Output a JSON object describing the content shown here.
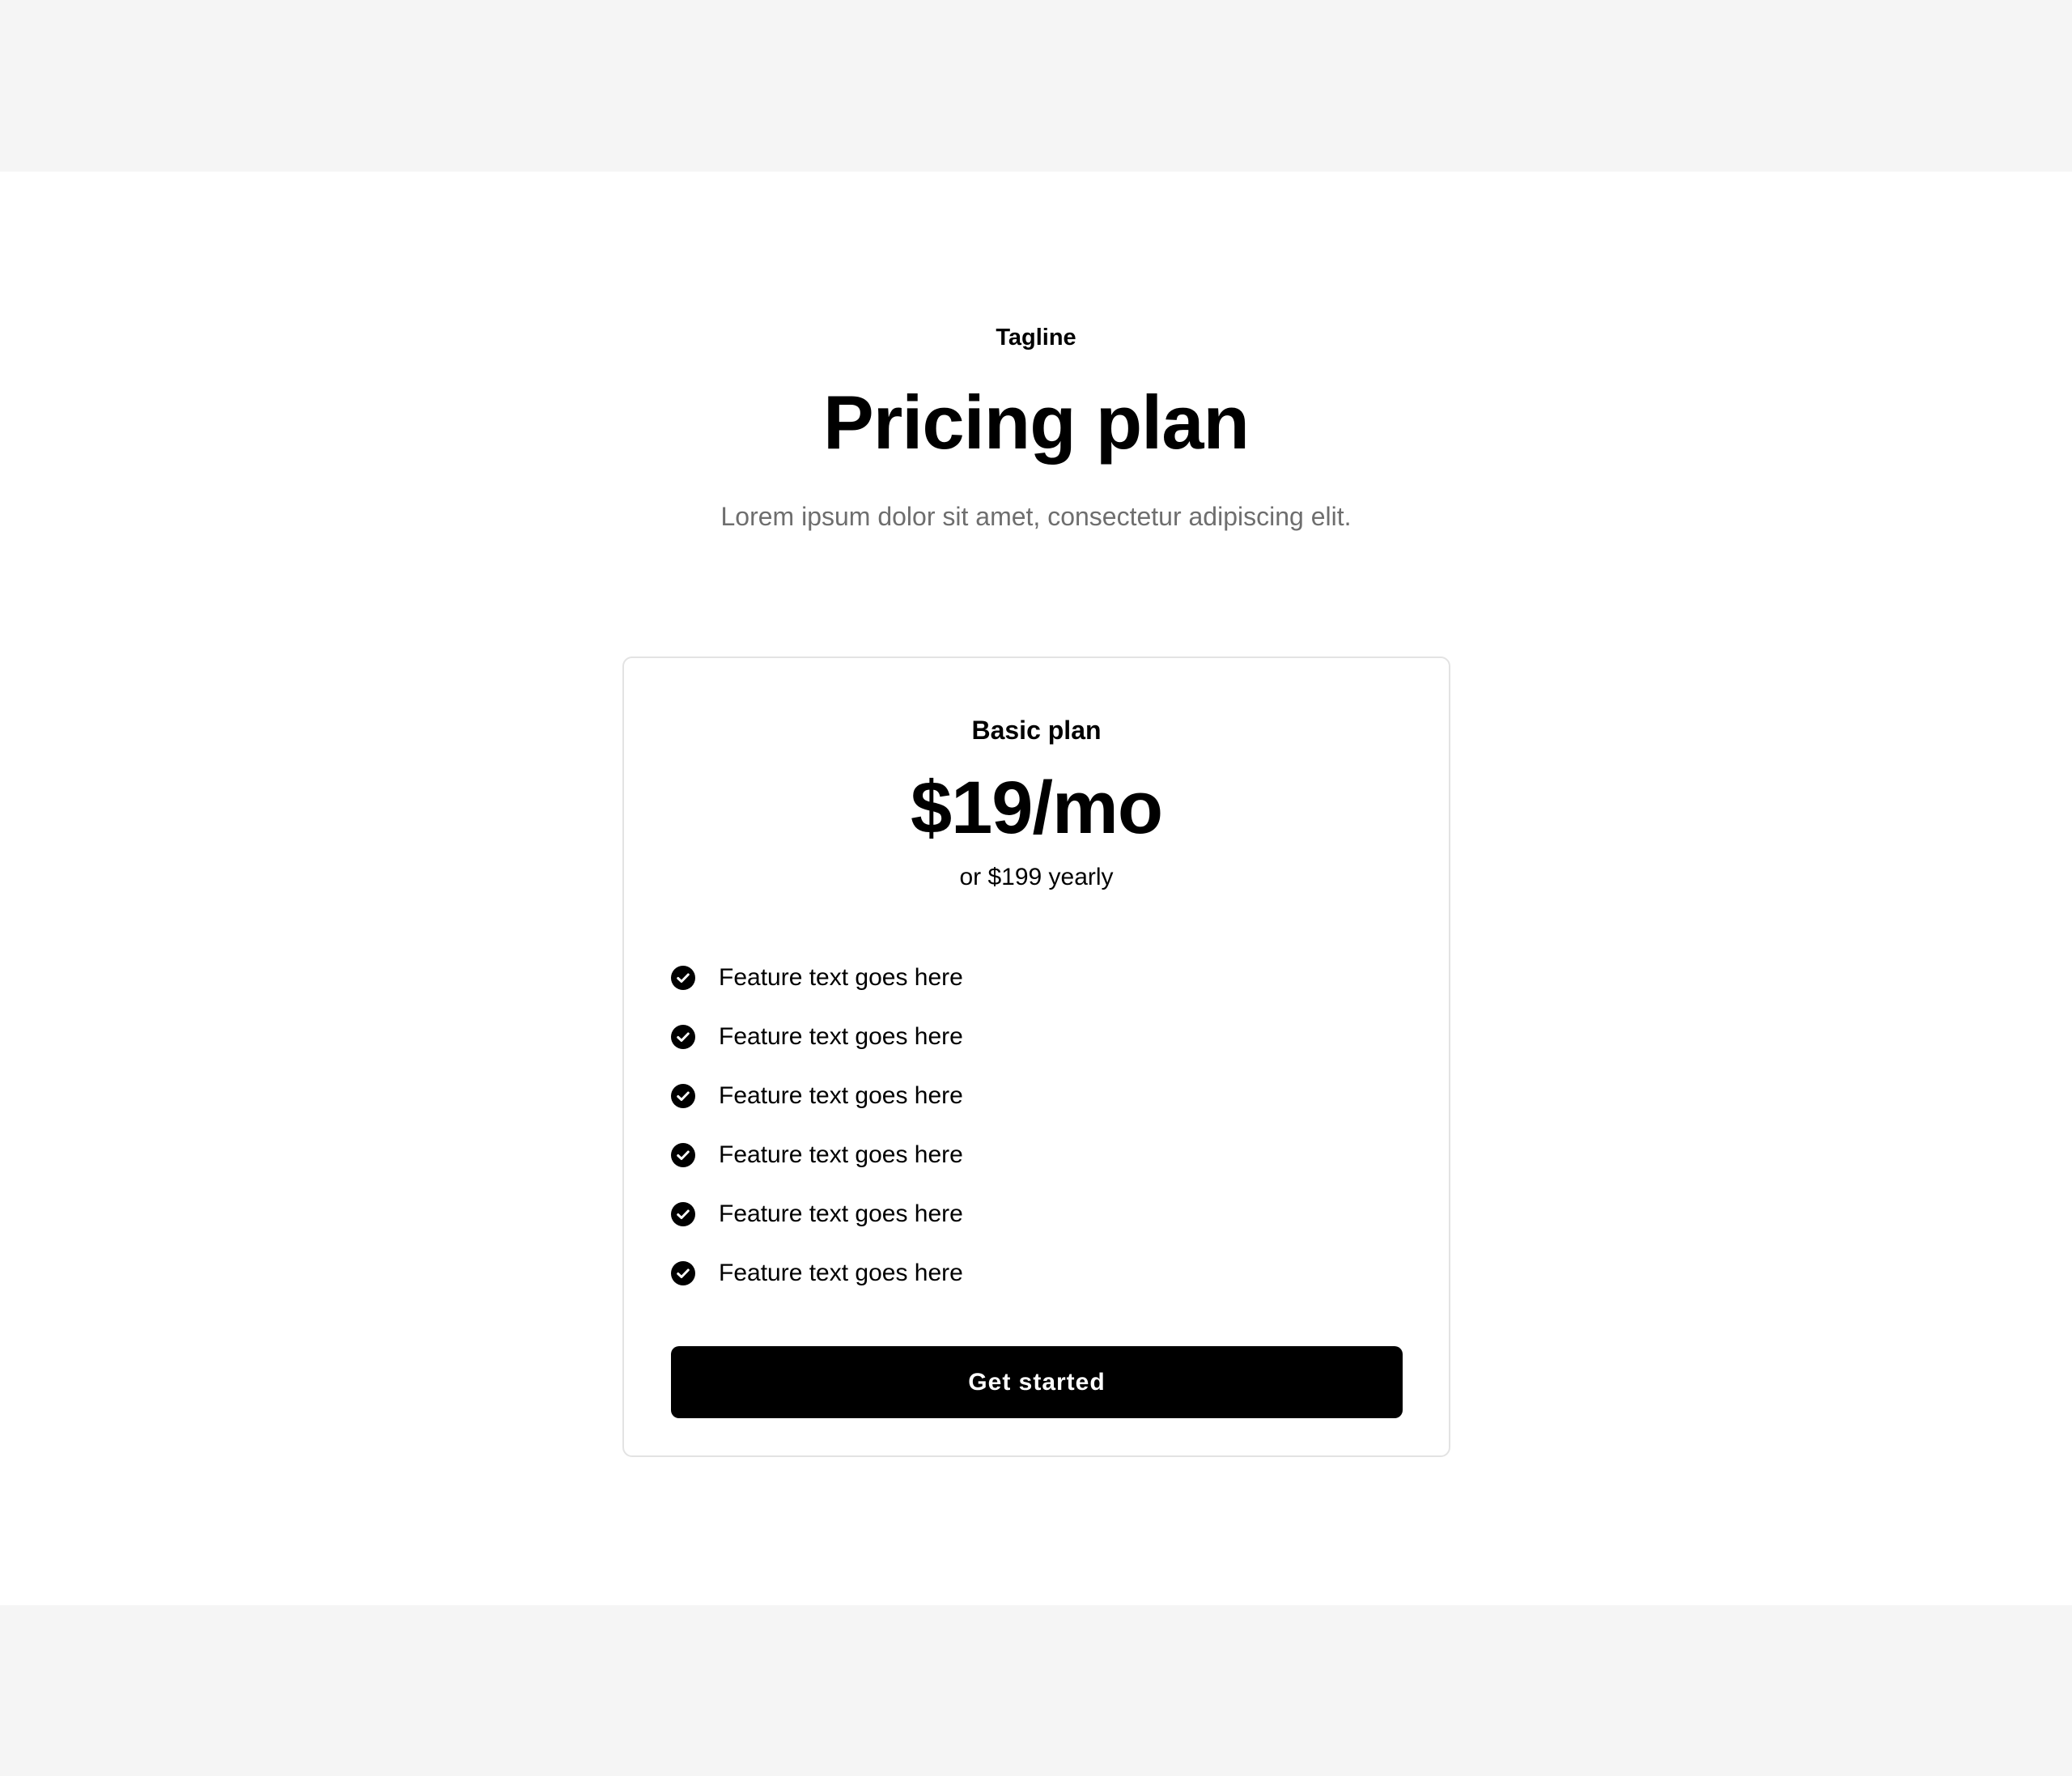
{
  "header": {
    "tagline": "Tagline",
    "title": "Pricing plan",
    "subtitle": "Lorem ipsum dolor sit amet, consectetur adipiscing elit."
  },
  "plan": {
    "name": "Basic plan",
    "price": "$19/mo",
    "yearly": "or $199 yearly",
    "features": [
      {
        "label": "Feature text goes here",
        "icon": "check-circle-icon"
      },
      {
        "label": "Feature text goes here",
        "icon": "check-circle-icon"
      },
      {
        "label": "Feature text goes here",
        "icon": "check-circle-icon"
      },
      {
        "label": "Feature text goes here",
        "icon": "check-circle-icon"
      },
      {
        "label": "Feature text goes here",
        "icon": "check-circle-icon"
      },
      {
        "label": "Feature text goes here",
        "icon": "check-circle-icon"
      }
    ],
    "cta_label": "Get started"
  },
  "colors": {
    "page_background": "#f5f5f5",
    "section_background": "#ffffff",
    "text_primary": "#000000",
    "text_muted": "#6e6e6e",
    "card_border": "#e3e3e3",
    "button_background": "#000000",
    "button_text": "#ffffff"
  }
}
